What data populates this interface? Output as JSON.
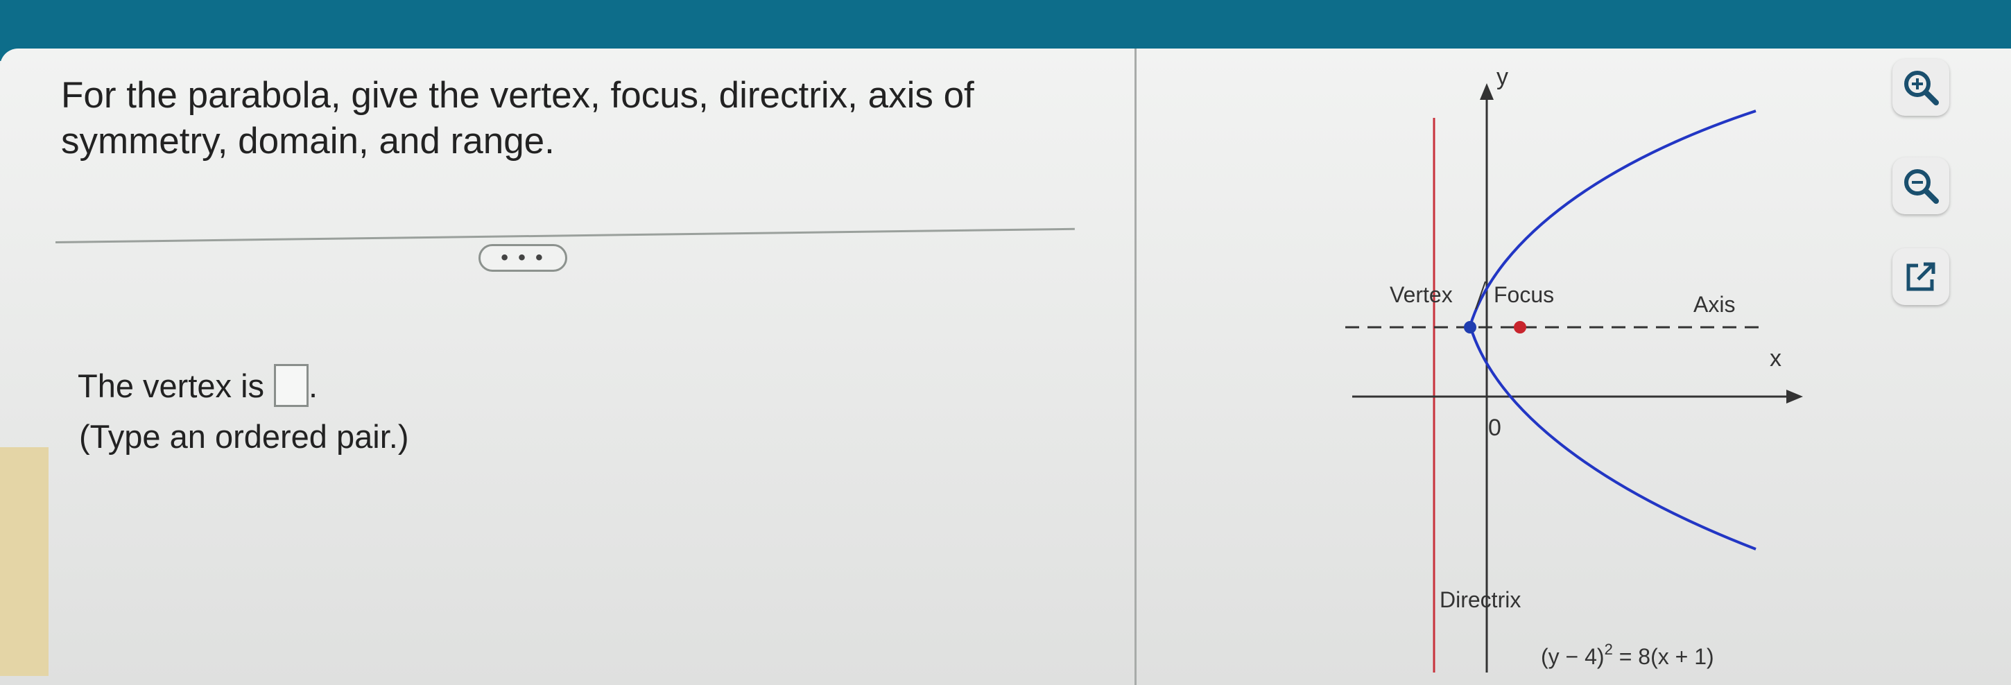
{
  "question": {
    "line1": "For the parabola, give the vertex, focus, directrix, axis of",
    "line2": "symmetry, domain, and range."
  },
  "more_button": "• • •",
  "answer": {
    "prefix": "The vertex is",
    "suffix": ".",
    "value": "",
    "hint": "(Type an ordered pair.)"
  },
  "graph": {
    "y_label": "y",
    "x_label": "x",
    "origin_label": "0",
    "vertex_label": "Vertex",
    "focus_label": "Focus",
    "axis_label": "Axis",
    "directrix_label": "Directrix",
    "equation_prefix": "(y − 4)",
    "equation_exp": "2",
    "equation_suffix": " = 8(x + 1)",
    "colors": {
      "parabola": "#2236c4",
      "directrix": "#c8323c",
      "vertex_point": "#1f3db0",
      "focus_point": "#c8252d",
      "axes": "#333333"
    }
  },
  "toolbar": {
    "zoom_in": "zoom-in-icon",
    "zoom_out": "zoom-out-icon",
    "open_new": "external-link-icon"
  }
}
